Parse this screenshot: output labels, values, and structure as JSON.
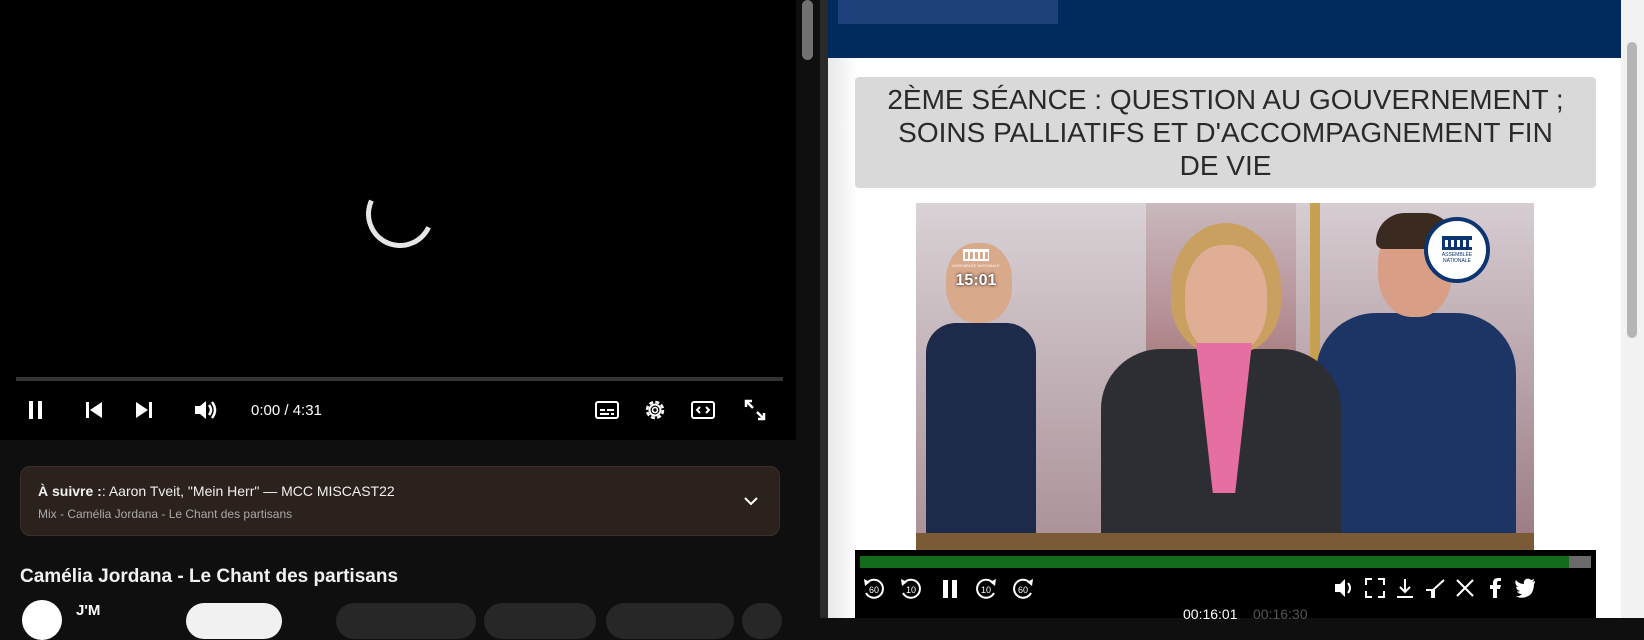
{
  "left_player": {
    "time": "0:00 / 4:31",
    "up_next": {
      "label": "À suivre :",
      "title": ": Aaron Tveit, \"Mein Herr\" — MCC MISCAST22",
      "playlist": "Mix - Camélia Jordana - Le Chant des partisans"
    },
    "video_title": "Camélia Jordana - Le Chant des partisans",
    "channel_name": "J'M"
  },
  "right_player": {
    "session_title": "2ÈME SÉANCE : QUESTION AU GOUVERNEMENT ; SOINS PALLIATIFS ET D'ACCOMPAGNEMENT FIN DE VIE",
    "watermark_time": "15:01",
    "logo_text": "ASSEMBLÉE NATIONALE",
    "current_time": "00:16:01",
    "duration": "00:16:30",
    "progress": 0.97,
    "skip_labels": [
      "60",
      "10",
      "10",
      "60"
    ]
  },
  "colors": {
    "yt_bg": "#0f0f0f",
    "an_navy": "#002b5c",
    "an_progress": "#116b1a"
  }
}
